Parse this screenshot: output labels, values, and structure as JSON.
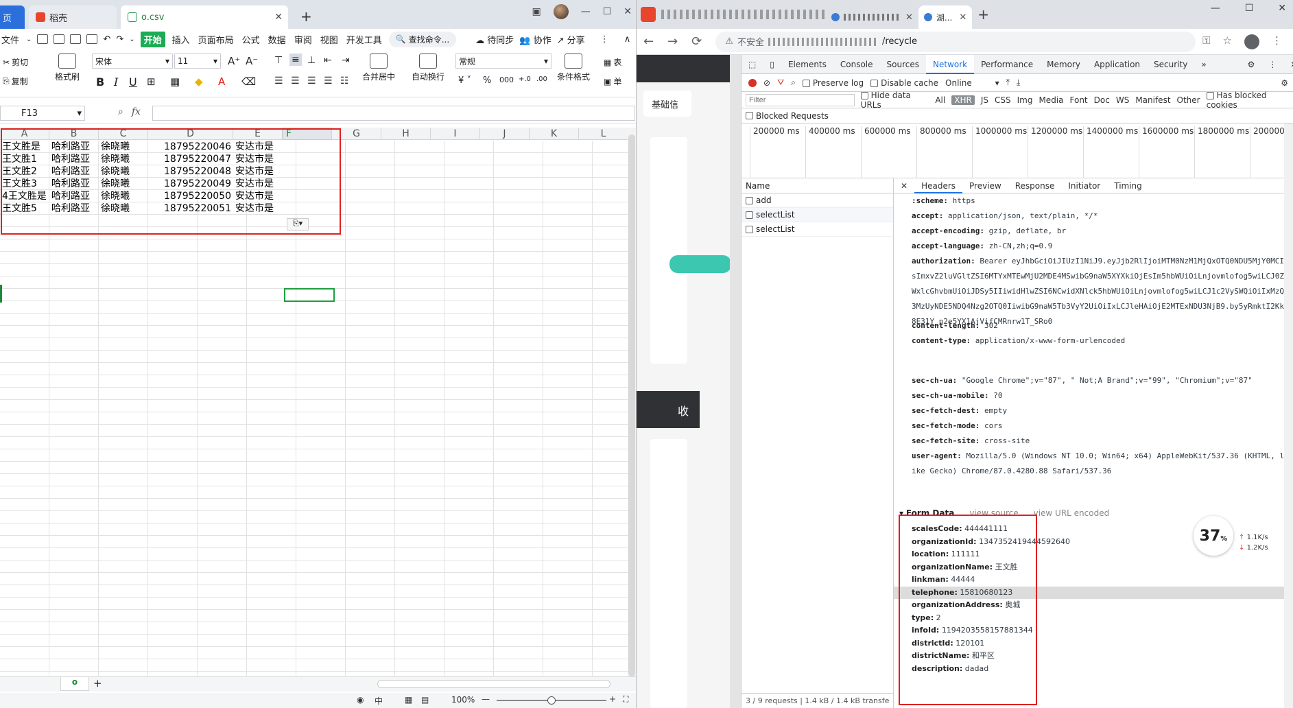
{
  "wps": {
    "tabs": [
      {
        "label": "页"
      },
      {
        "label": "稻壳"
      },
      {
        "label": "o.csv"
      }
    ],
    "menu": {
      "file": "文件",
      "items": [
        "开始",
        "插入",
        "页面布局",
        "公式",
        "数据",
        "审阅",
        "视图",
        "开发工具"
      ],
      "search": "查找命令...",
      "sync": "待同步",
      "collab": "协作",
      "share": "分享"
    },
    "ribbon": {
      "cut": "剪切",
      "copy": "复制",
      "format_painter": "格式刷",
      "font": "宋体",
      "size": "11",
      "merge": "合并居中",
      "wrap": "自动换行",
      "number_format": "常规",
      "cond_format": "条件格式",
      "table": "表",
      "cell": "单"
    },
    "namebox": "F13",
    "fx": "fx",
    "columns": [
      "A",
      "B",
      "C",
      "D",
      "E",
      "F",
      "G",
      "H",
      "I",
      "J",
      "K",
      "L"
    ],
    "rows": [
      [
        "王文胜是",
        "哈利路亚",
        "徐晓曦",
        "18795220046",
        "安达市是"
      ],
      [
        "王文胜1",
        "哈利路亚",
        "徐晓曦",
        "18795220047",
        "安达市是"
      ],
      [
        "王文胜2",
        "哈利路亚",
        "徐晓曦",
        "18795220048",
        "安达市是"
      ],
      [
        "王文胜3",
        "哈利路亚",
        "徐晓曦",
        "18795220049",
        "安达市是"
      ],
      [
        "4王文胜是",
        "哈利路亚",
        "徐晓曦",
        "18795220050",
        "安达市是"
      ],
      [
        "王文胜5",
        "哈利路亚",
        "徐晓曦",
        "18795220051",
        "安达市是"
      ]
    ],
    "sheet_tab": "o",
    "zoom": "100%"
  },
  "chrome": {
    "tab2": "湖...",
    "addr_warning": "不安全",
    "addr_url": "/recycle",
    "devtools": {
      "tabs": [
        "Elements",
        "Console",
        "Sources",
        "Network",
        "Performance",
        "Memory",
        "Application",
        "Security"
      ],
      "active_tab": "Network",
      "preserve_log": "Preserve log",
      "disable_cache": "Disable cache",
      "online": "Online",
      "filter_placeholder": "Filter",
      "hide_data_urls": "Hide data URLs",
      "filter_types": [
        "All",
        "XHR",
        "JS",
        "CSS",
        "Img",
        "Media",
        "Font",
        "Doc",
        "WS",
        "Manifest",
        "Other"
      ],
      "has_blocked": "Has blocked cookies",
      "blocked_requests": "Blocked Requests",
      "timeline": [
        "200000 ms",
        "400000 ms",
        "600000 ms",
        "800000 ms",
        "1000000 ms",
        "1200000 ms",
        "1400000 ms",
        "1600000 ms",
        "1800000 ms",
        "2000000 m"
      ],
      "name_header": "Name",
      "requests": [
        "add",
        "selectList",
        "selectList"
      ],
      "footer": "3 / 9 requests | 1.4 kB / 1.4 kB transfe",
      "detail_tabs": [
        "Headers",
        "Preview",
        "Response",
        "Initiator",
        "Timing"
      ],
      "headers": [
        {
          "k": ":scheme:",
          "v": "https"
        },
        {
          "k": "accept:",
          "v": "application/json, text/plain, */*"
        },
        {
          "k": "accept-encoding:",
          "v": "gzip, deflate, br"
        },
        {
          "k": "accept-language:",
          "v": "zh-CN,zh;q=0.9"
        },
        {
          "k": "authorization:",
          "v": "Bearer eyJhbGciOiJIUzI1NiJ9.eyJjb2RlIjoiMTM0NzM1MjQxOTQ0NDU5MjY0MCIsImxvZ2luVGltZSI6MTYxMTEwMjU2MDE4MSwibG9naW5XYXkiOjEsIm5hbWUiOiLnjovmlofog5wiLCJ0ZWxlcGhvbmUiOiJDSy5IIiwidHlwZSI6NCwidXNlck5hbWUiOiLnjovmlofog5wiLCJ1c2VySWQiOiIxMzQ3MzUyNDE5NDQ4Nzg2OTQ0IiwibG9naW5Tb3VyY2UiOiIxLCJleHAiOjE2MTExNDU3NjB9.by5yRmktI2Kk8E31Y_n2e5YX1AjVifCMRnrw1T_SRo0"
        },
        {
          "k": "content-length:",
          "v": "302"
        },
        {
          "k": "content-type:",
          "v": "application/x-www-form-urlencoded"
        },
        {
          "k": "sec-ch-ua:",
          "v": "\"Google Chrome\";v=\"87\", \" Not;A Brand\";v=\"99\", \"Chromium\";v=\"87\""
        },
        {
          "k": "sec-ch-ua-mobile:",
          "v": "?0"
        },
        {
          "k": "sec-fetch-dest:",
          "v": "empty"
        },
        {
          "k": "sec-fetch-mode:",
          "v": "cors"
        },
        {
          "k": "sec-fetch-site:",
          "v": "cross-site"
        },
        {
          "k": "user-agent:",
          "v": "Mozilla/5.0 (Windows NT 10.0; Win64; x64) AppleWebKit/537.36 (KHTML, like Gecko) Chrome/87.0.4280.88 Safari/537.36"
        }
      ],
      "form_data_title": "Form Data",
      "view_source": "view source",
      "view_url_encoded": "view URL encoded",
      "form_data": [
        {
          "k": "scalesCode:",
          "v": "444441111"
        },
        {
          "k": "organizationId:",
          "v": "1347352419444592640"
        },
        {
          "k": "location:",
          "v": "111111"
        },
        {
          "k": "organizationName:",
          "v": "王文胜"
        },
        {
          "k": "linkman:",
          "v": "44444"
        },
        {
          "k": "telephone:",
          "v": "15810680123"
        },
        {
          "k": "organizationAddress:",
          "v": "奥城"
        },
        {
          "k": "type:",
          "v": "2"
        },
        {
          "k": "infoId:",
          "v": "1194203558157881344"
        },
        {
          "k": "districtId:",
          "v": "120101"
        },
        {
          "k": "districtName:",
          "v": "和平区"
        },
        {
          "k": "description:",
          "v": "dadad"
        }
      ]
    },
    "gauge": {
      "value": "37",
      "unit": "%",
      "up": "1.1K/s",
      "down": "1.2K/s"
    },
    "page_text": {
      "base": "基础信",
      "collect": "收"
    }
  },
  "colors": {
    "accent_green": "#1aad53",
    "red_box": "#e02020",
    "devtools_blue": "#1a73e8"
  }
}
